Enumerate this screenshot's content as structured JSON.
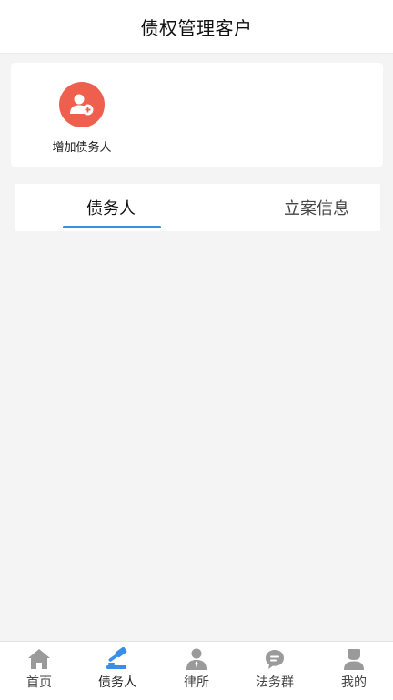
{
  "header": {
    "title": "债权管理客户"
  },
  "actions": {
    "add_debtor_label": "增加债务人",
    "add_icon": "add-user-icon"
  },
  "tabs": [
    {
      "label": "债务人",
      "active": true
    },
    {
      "label": "立案信息",
      "active": false
    }
  ],
  "bottom_nav": [
    {
      "label": "首页",
      "icon": "home-icon",
      "active": false
    },
    {
      "label": "债务人",
      "icon": "gavel-icon",
      "active": true
    },
    {
      "label": "律所",
      "icon": "lawyer-icon",
      "active": false
    },
    {
      "label": "法务群",
      "icon": "chat-icon",
      "active": false
    },
    {
      "label": "我的",
      "icon": "profile-icon",
      "active": false
    }
  ],
  "colors": {
    "accent": "#3a8ee6",
    "add_button": "#ee5f4e",
    "icon_gray": "#9a9a9a",
    "background": "#f4f4f4"
  }
}
